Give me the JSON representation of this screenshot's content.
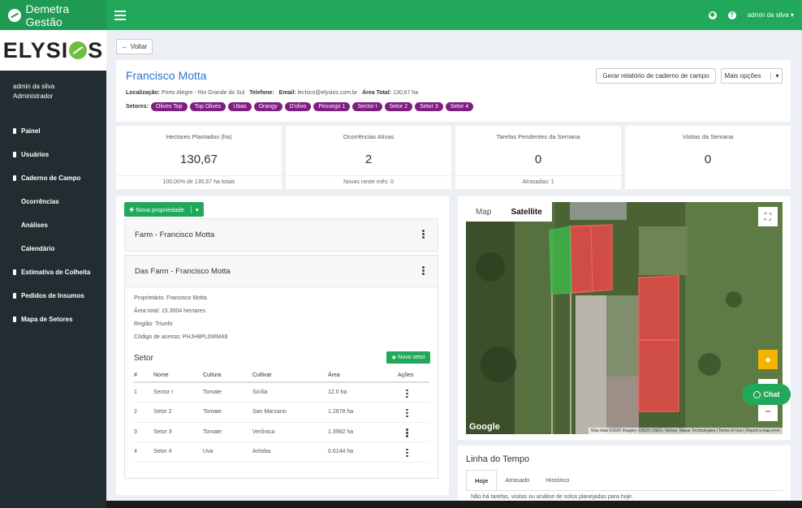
{
  "app": {
    "brand": "Demetra Gestão",
    "user_menu": "admin da silva"
  },
  "sidebar": {
    "logo": {
      "prefix": "ELYSI",
      "suffix": "S"
    },
    "user_name": "admin da silva",
    "user_role": "Administrador",
    "items": [
      {
        "label": "Painel"
      },
      {
        "label": "Usuários"
      },
      {
        "label": "Caderno de Campo"
      },
      {
        "label": "Ocorrências"
      },
      {
        "label": "Análises"
      },
      {
        "label": "Calendário"
      },
      {
        "label": "Estimativa de Colheita"
      },
      {
        "label": "Pedidos de Insumos"
      },
      {
        "label": "Mapa de Setores"
      }
    ]
  },
  "toolbar": {
    "back_label": "Voltar"
  },
  "person": {
    "name": "Francisco Motta",
    "location_label": "Localização:",
    "location": "Porto Alegre - Rio Grande do Sul",
    "phone_label": "Telefone:",
    "email_label": "Email:",
    "email": "lechico@elysios.com.br",
    "area_label": "Área Total:",
    "area": "130,67 ha",
    "sectors_label": "Setores:",
    "sectors": [
      "Olives Top",
      "Top Olives",
      "Ubas",
      "Orangy",
      "D'olivo",
      "Pessego 1",
      "Sector I",
      "Setor 2",
      "Setor 3",
      "Setor 4"
    ],
    "report_button": "Gerar relatório de caderno de campo",
    "more_button": "Mais opções"
  },
  "stats": [
    {
      "title": "Hectares Plantados (ha)",
      "value": "130,67",
      "footer": "100,00% de 130,67 ha totais"
    },
    {
      "title": "Ocorrências Ativas",
      "value": "2",
      "footer": "Novas neste mês: 0"
    },
    {
      "title": "Tarefas Pendentes da Semana",
      "value": "0",
      "footer": "Atrasadas: 1"
    },
    {
      "title": "Visitas da Semana",
      "value": "0",
      "footer": ""
    }
  ],
  "properties": {
    "new_button": "Nova propriedade",
    "farms": [
      {
        "title": "Farm - Francisco Motta"
      },
      {
        "title": "Das Farm - Francisco Motta",
        "owner": "Proprietário: Francisco Motta",
        "area": "Área total: 15.3004 hectares",
        "region": "Região: Triunfo",
        "access_code": "Código de acesso: PHJH8PL0WMA9"
      }
    ],
    "setor_title": "Setor",
    "new_setor_button": "Novo setor",
    "columns": [
      "#",
      "Nome",
      "Cultura",
      "Cultivar",
      "Área",
      "Ações"
    ],
    "rows": [
      {
        "n": "1",
        "nome": "Sector I",
        "cultura": "Tomate",
        "cultivar": "Sicília",
        "area": "12.0 ha"
      },
      {
        "n": "2",
        "nome": "Setor 2",
        "cultura": "Tomate",
        "cultivar": "San Marzano",
        "area": "1.2878 ha"
      },
      {
        "n": "3",
        "nome": "Setor 3",
        "cultura": "Tomate",
        "cultivar": "Verônica",
        "area": "1.3982 ha"
      },
      {
        "n": "4",
        "nome": "Setor 4",
        "cultura": "Uva",
        "cultivar": "Aritoba",
        "area": "0.6144 ha"
      }
    ]
  },
  "map": {
    "tabs": [
      "Map",
      "Satellite"
    ],
    "active_tab": "Satellite",
    "google": "Google",
    "attribution": "Map data ©2020 Imagery ©2020 CNES / Airbus, Maxar Technologies | Terms of Use | Report a map error",
    "colors": {
      "field_red": "#e84a4a",
      "field_green": "#3fb34a"
    }
  },
  "chat": {
    "label": "Chat"
  },
  "timeline": {
    "title": "Linha do Tempo",
    "tabs": [
      "Hoje",
      "Atrasado",
      "Histórico"
    ],
    "empty_text": "Não há tarefas, visitas ou análise de solos planejadas para hoje."
  }
}
